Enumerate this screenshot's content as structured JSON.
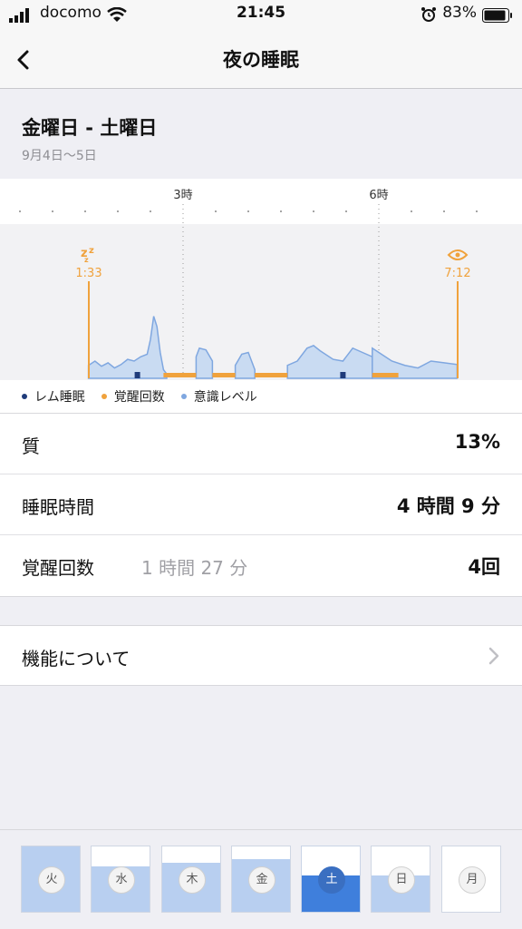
{
  "status_bar": {
    "carrier": "docomo",
    "time": "21:45",
    "battery": "83%"
  },
  "nav": {
    "title": "夜の睡眠"
  },
  "header": {
    "day_range": "金曜日 - 土曜日",
    "date_range": "9月4日～5日"
  },
  "chart_data": {
    "type": "area",
    "tick_labels": [
      "3時",
      "6時"
    ],
    "start": {
      "time": "1:33",
      "icon": "zzz-sleep-icon"
    },
    "end": {
      "time": "7:12",
      "icon": "eye-icon"
    },
    "legend": [
      {
        "label": "レム睡眠",
        "color": "#1f3b7a"
      },
      {
        "label": "覚醒回数",
        "color": "#f0a23c"
      },
      {
        "label": "意識レベル",
        "color": "#7fa7e0"
      }
    ],
    "series_consciousness": {
      "x": [
        1.55,
        1.65,
        1.75,
        1.85,
        1.95,
        2.05,
        2.15,
        2.25,
        2.35,
        2.45,
        2.5,
        2.55,
        2.6,
        2.65,
        2.7,
        2.75
      ],
      "y": [
        0.15,
        0.2,
        0.14,
        0.18,
        0.12,
        0.16,
        0.22,
        0.2,
        0.25,
        0.28,
        0.45,
        0.72,
        0.6,
        0.3,
        0.1,
        0.05
      ]
    },
    "awake_segments": [
      [
        2.7,
        3.2
      ],
      [
        3.45,
        3.8
      ],
      [
        4.1,
        4.6
      ],
      [
        5.9,
        6.3
      ]
    ],
    "rem_marks": [
      2.3,
      5.45
    ],
    "accent_start": "#f0a23c",
    "accent_end": "#f0a23c"
  },
  "stats": [
    {
      "label": "質",
      "sub": "",
      "value": "13%"
    },
    {
      "label": "睡眠時間",
      "sub": "",
      "value": "4 時間 9 分"
    },
    {
      "label": "覚醒回数",
      "sub": "1 時間 27 分",
      "value": "4回"
    }
  ],
  "about": {
    "label": "機能について"
  },
  "week": [
    {
      "label": "火",
      "level": 1.0,
      "selected": false
    },
    {
      "label": "水",
      "level": 0.7,
      "selected": false
    },
    {
      "label": "木",
      "level": 0.75,
      "selected": false
    },
    {
      "label": "金",
      "level": 0.8,
      "selected": false
    },
    {
      "label": "土",
      "level": 0.55,
      "selected": true
    },
    {
      "label": "日",
      "level": 0.55,
      "selected": false
    },
    {
      "label": "月",
      "level": 0.0,
      "selected": false
    }
  ]
}
